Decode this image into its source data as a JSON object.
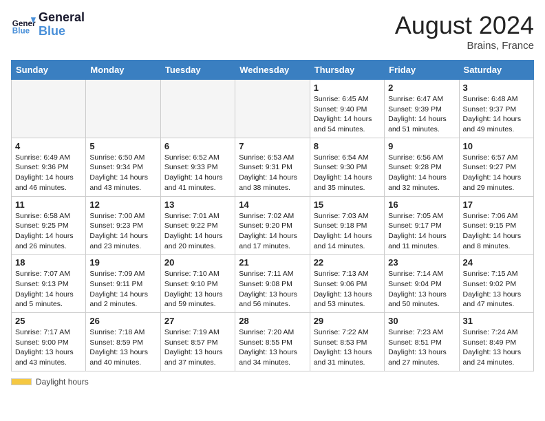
{
  "header": {
    "logo_line1": "General",
    "logo_line2": "Blue",
    "month_year": "August 2024",
    "location": "Brains, France"
  },
  "weekdays": [
    "Sunday",
    "Monday",
    "Tuesday",
    "Wednesday",
    "Thursday",
    "Friday",
    "Saturday"
  ],
  "weeks": [
    [
      {
        "day": "",
        "info": ""
      },
      {
        "day": "",
        "info": ""
      },
      {
        "day": "",
        "info": ""
      },
      {
        "day": "",
        "info": ""
      },
      {
        "day": "1",
        "info": "Sunrise: 6:45 AM\nSunset: 9:40 PM\nDaylight: 14 hours\nand 54 minutes."
      },
      {
        "day": "2",
        "info": "Sunrise: 6:47 AM\nSunset: 9:39 PM\nDaylight: 14 hours\nand 51 minutes."
      },
      {
        "day": "3",
        "info": "Sunrise: 6:48 AM\nSunset: 9:37 PM\nDaylight: 14 hours\nand 49 minutes."
      }
    ],
    [
      {
        "day": "4",
        "info": "Sunrise: 6:49 AM\nSunset: 9:36 PM\nDaylight: 14 hours\nand 46 minutes."
      },
      {
        "day": "5",
        "info": "Sunrise: 6:50 AM\nSunset: 9:34 PM\nDaylight: 14 hours\nand 43 minutes."
      },
      {
        "day": "6",
        "info": "Sunrise: 6:52 AM\nSunset: 9:33 PM\nDaylight: 14 hours\nand 41 minutes."
      },
      {
        "day": "7",
        "info": "Sunrise: 6:53 AM\nSunset: 9:31 PM\nDaylight: 14 hours\nand 38 minutes."
      },
      {
        "day": "8",
        "info": "Sunrise: 6:54 AM\nSunset: 9:30 PM\nDaylight: 14 hours\nand 35 minutes."
      },
      {
        "day": "9",
        "info": "Sunrise: 6:56 AM\nSunset: 9:28 PM\nDaylight: 14 hours\nand 32 minutes."
      },
      {
        "day": "10",
        "info": "Sunrise: 6:57 AM\nSunset: 9:27 PM\nDaylight: 14 hours\nand 29 minutes."
      }
    ],
    [
      {
        "day": "11",
        "info": "Sunrise: 6:58 AM\nSunset: 9:25 PM\nDaylight: 14 hours\nand 26 minutes."
      },
      {
        "day": "12",
        "info": "Sunrise: 7:00 AM\nSunset: 9:23 PM\nDaylight: 14 hours\nand 23 minutes."
      },
      {
        "day": "13",
        "info": "Sunrise: 7:01 AM\nSunset: 9:22 PM\nDaylight: 14 hours\nand 20 minutes."
      },
      {
        "day": "14",
        "info": "Sunrise: 7:02 AM\nSunset: 9:20 PM\nDaylight: 14 hours\nand 17 minutes."
      },
      {
        "day": "15",
        "info": "Sunrise: 7:03 AM\nSunset: 9:18 PM\nDaylight: 14 hours\nand 14 minutes."
      },
      {
        "day": "16",
        "info": "Sunrise: 7:05 AM\nSunset: 9:17 PM\nDaylight: 14 hours\nand 11 minutes."
      },
      {
        "day": "17",
        "info": "Sunrise: 7:06 AM\nSunset: 9:15 PM\nDaylight: 14 hours\nand 8 minutes."
      }
    ],
    [
      {
        "day": "18",
        "info": "Sunrise: 7:07 AM\nSunset: 9:13 PM\nDaylight: 14 hours\nand 5 minutes."
      },
      {
        "day": "19",
        "info": "Sunrise: 7:09 AM\nSunset: 9:11 PM\nDaylight: 14 hours\nand 2 minutes."
      },
      {
        "day": "20",
        "info": "Sunrise: 7:10 AM\nSunset: 9:10 PM\nDaylight: 13 hours\nand 59 minutes."
      },
      {
        "day": "21",
        "info": "Sunrise: 7:11 AM\nSunset: 9:08 PM\nDaylight: 13 hours\nand 56 minutes."
      },
      {
        "day": "22",
        "info": "Sunrise: 7:13 AM\nSunset: 9:06 PM\nDaylight: 13 hours\nand 53 minutes."
      },
      {
        "day": "23",
        "info": "Sunrise: 7:14 AM\nSunset: 9:04 PM\nDaylight: 13 hours\nand 50 minutes."
      },
      {
        "day": "24",
        "info": "Sunrise: 7:15 AM\nSunset: 9:02 PM\nDaylight: 13 hours\nand 47 minutes."
      }
    ],
    [
      {
        "day": "25",
        "info": "Sunrise: 7:17 AM\nSunset: 9:00 PM\nDaylight: 13 hours\nand 43 minutes."
      },
      {
        "day": "26",
        "info": "Sunrise: 7:18 AM\nSunset: 8:59 PM\nDaylight: 13 hours\nand 40 minutes."
      },
      {
        "day": "27",
        "info": "Sunrise: 7:19 AM\nSunset: 8:57 PM\nDaylight: 13 hours\nand 37 minutes."
      },
      {
        "day": "28",
        "info": "Sunrise: 7:20 AM\nSunset: 8:55 PM\nDaylight: 13 hours\nand 34 minutes."
      },
      {
        "day": "29",
        "info": "Sunrise: 7:22 AM\nSunset: 8:53 PM\nDaylight: 13 hours\nand 31 minutes."
      },
      {
        "day": "30",
        "info": "Sunrise: 7:23 AM\nSunset: 8:51 PM\nDaylight: 13 hours\nand 27 minutes."
      },
      {
        "day": "31",
        "info": "Sunrise: 7:24 AM\nSunset: 8:49 PM\nDaylight: 13 hours\nand 24 minutes."
      }
    ]
  ],
  "footer": {
    "daylight_label": "Daylight hours"
  }
}
